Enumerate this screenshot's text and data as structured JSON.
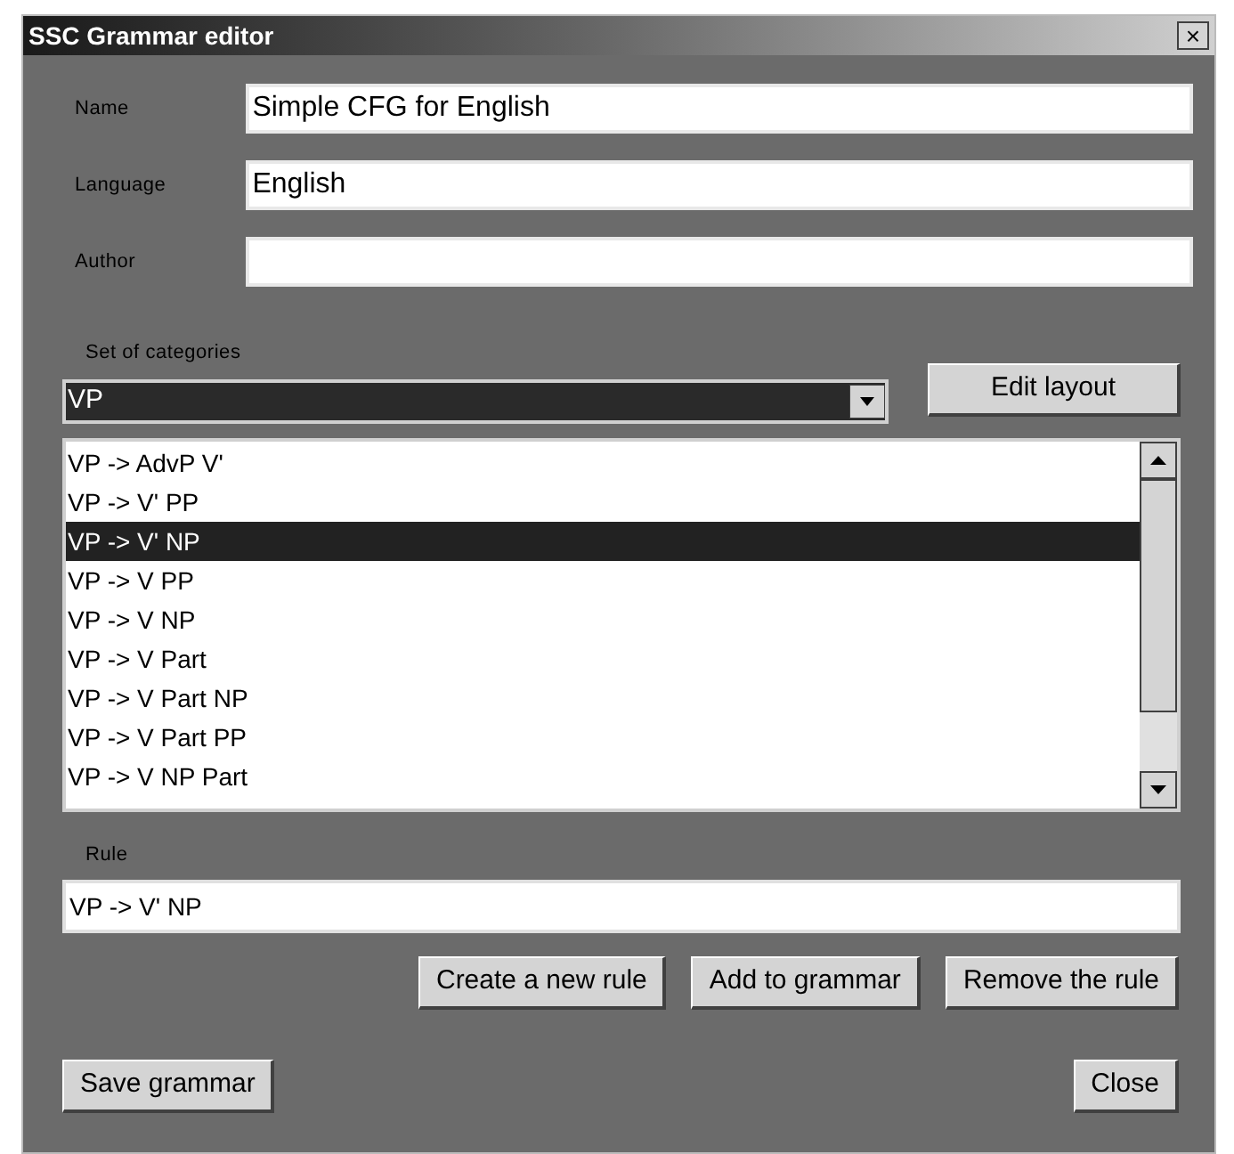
{
  "window": {
    "title": "SSC Grammar editor",
    "close": "×"
  },
  "fields": [
    {
      "label": "Name",
      "value": "Simple CFG for English"
    },
    {
      "label": "Language",
      "value": "English"
    },
    {
      "label": "Author"
    }
  ],
  "categories": {
    "label": "Set of categories",
    "selected_value": "VP",
    "edit_button": "Edit layout"
  },
  "rules_list": [
    {
      "text": "VP -> AdvP V'",
      "selected": false
    },
    {
      "text": "VP -> V' PP",
      "selected": false
    },
    {
      "text": "VP -> V' NP",
      "selected": true
    },
    {
      "text": "VP -> V PP",
      "selected": false
    },
    {
      "text": "VP -> V NP",
      "selected": false
    },
    {
      "text": "VP -> V Part",
      "selected": false
    },
    {
      "text": "VP -> V Part NP",
      "selected": false
    },
    {
      "text": "VP -> V Part PP",
      "selected": false
    },
    {
      "text": "VP -> V NP Part",
      "selected": false
    }
  ],
  "rule": {
    "label": "Rule",
    "value": "VP -> V' NP"
  },
  "rule_buttons": [
    "Create a new rule",
    "Add to grammar",
    "Remove the rule"
  ],
  "footer_buttons": [
    "Save grammar",
    "Close"
  ]
}
